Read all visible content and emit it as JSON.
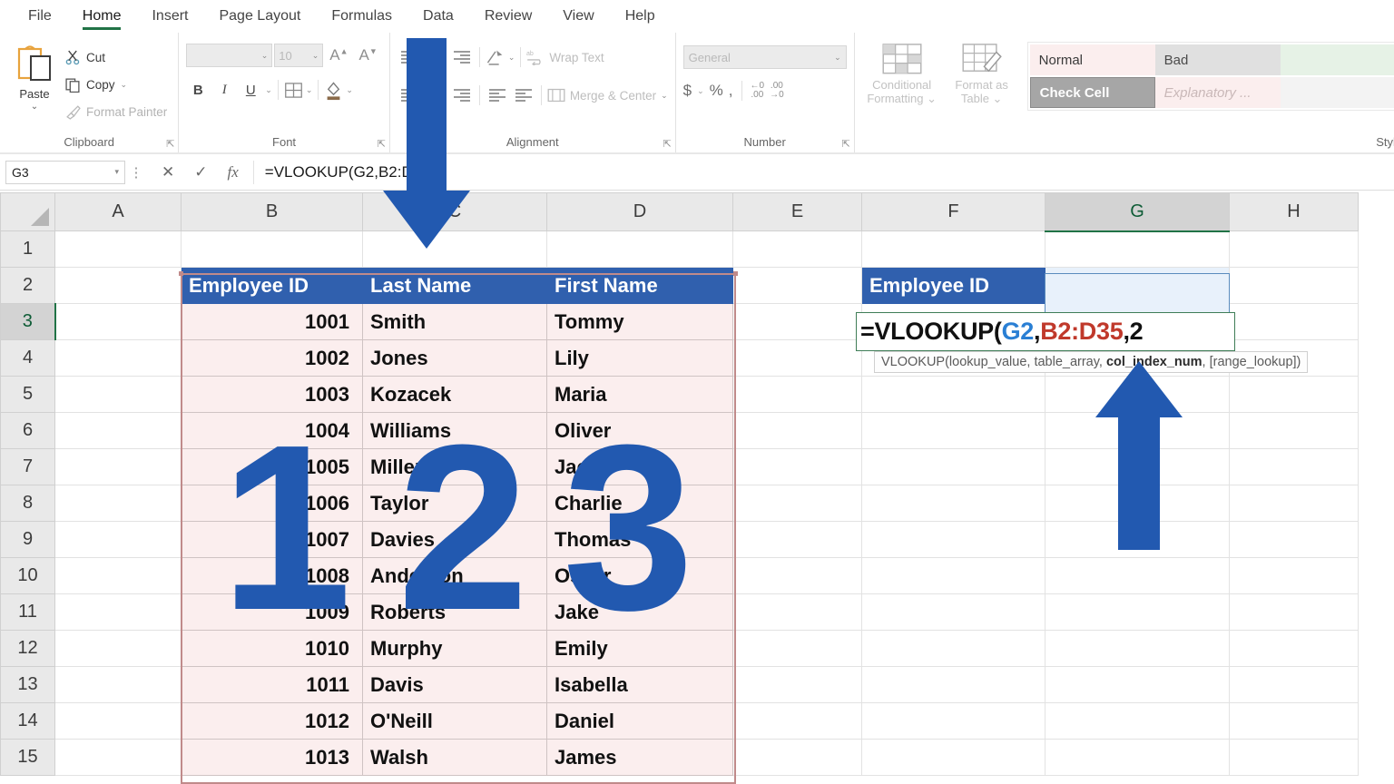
{
  "app": {
    "accent_green": "#217346",
    "annotation_blue": "#2259b0"
  },
  "ribbon": {
    "tabs": [
      {
        "label": "File",
        "active": false
      },
      {
        "label": "Home",
        "active": true
      },
      {
        "label": "Insert",
        "active": false
      },
      {
        "label": "Page Layout",
        "active": false
      },
      {
        "label": "Formulas",
        "active": false
      },
      {
        "label": "Data",
        "active": false
      },
      {
        "label": "Review",
        "active": false
      },
      {
        "label": "View",
        "active": false
      },
      {
        "label": "Help",
        "active": false
      }
    ],
    "clipboard": {
      "group_label": "Clipboard",
      "paste_label": "Paste",
      "cut_label": "Cut",
      "copy_label": "Copy",
      "format_painter_label": "Format Painter"
    },
    "font": {
      "group_label": "Font",
      "font_name": "",
      "font_size": "10",
      "grow_label": "A",
      "shrink_label": "A",
      "bold_label": "B",
      "italic_label": "I",
      "underline_label": "U"
    },
    "alignment": {
      "group_label": "Alignment",
      "wrap_text_label": "Wrap Text",
      "merge_center_label": "Merge & Center",
      "orientation_icon": "text-orientation-icon"
    },
    "number": {
      "group_label": "Number",
      "format_value": "General",
      "currency_label": "$",
      "percent_label": "%",
      "comma_label": ",",
      "increase_decimal_label": ".00",
      "decrease_decimal_label": ".00"
    },
    "styles": {
      "group_label": "Styles",
      "conditional_formatting_label": "Conditional\nFormatting",
      "conditional_formatting_line1": "Conditional",
      "conditional_formatting_line2": "Formatting",
      "format_as_table_line1": "Format as",
      "format_as_table_line2": "Table",
      "gallery": [
        {
          "label": "Normal",
          "state": "normal"
        },
        {
          "label": "Bad",
          "state": "bad"
        },
        {
          "label": "",
          "state": "good"
        },
        {
          "label": "Check Cell",
          "state": "check"
        },
        {
          "label": "Explanatory ...",
          "state": "explanatory"
        },
        {
          "label": "",
          "state": "blank"
        }
      ]
    }
  },
  "formula_bar": {
    "name_box": "G3",
    "cancel_icon": "close-icon",
    "confirm_icon": "check-icon",
    "fx_icon": "fx-icon",
    "formula": "=VLOOKUP(G2,B2:D35,2"
  },
  "grid": {
    "columns": [
      "A",
      "B",
      "C",
      "D",
      "E",
      "F",
      "G",
      "H"
    ],
    "active_column": "G",
    "active_row": "3",
    "rows": [
      "1",
      "2",
      "3",
      "4",
      "5",
      "6",
      "7",
      "8",
      "9",
      "10",
      "11",
      "12",
      "13",
      "14",
      "15"
    ]
  },
  "lookup_table": {
    "range": "B2:D35",
    "headers": [
      "Employee ID",
      "Last Name",
      "First Name"
    ],
    "rows": [
      {
        "row": "3",
        "id": "1001",
        "last": "Smith",
        "first": "Tommy"
      },
      {
        "row": "4",
        "id": "1002",
        "last": "Jones",
        "first": "Lily"
      },
      {
        "row": "5",
        "id": "1003",
        "last": "Kozacek",
        "first": "Maria"
      },
      {
        "row": "6",
        "id": "1004",
        "last": "Williams",
        "first": "Oliver"
      },
      {
        "row": "7",
        "id": "1005",
        "last": "Miller",
        "first": "Jack"
      },
      {
        "row": "8",
        "id": "1006",
        "last": "Taylor",
        "first": "Charlie"
      },
      {
        "row": "9",
        "id": "1007",
        "last": "Davies",
        "first": "Thomas"
      },
      {
        "row": "10",
        "id": "1008",
        "last": "Anderson",
        "first": "Oscar"
      },
      {
        "row": "11",
        "id": "1009",
        "last": "Roberts",
        "first": "Jake"
      },
      {
        "row": "12",
        "id": "1010",
        "last": "Murphy",
        "first": "Emily"
      },
      {
        "row": "13",
        "id": "1011",
        "last": "Davis",
        "first": "Isabella"
      },
      {
        "row": "14",
        "id": "1012",
        "last": "O'Neill",
        "first": "Daniel"
      },
      {
        "row": "15",
        "id": "1013",
        "last": "Walsh",
        "first": "James"
      }
    ]
  },
  "lookup_panel": {
    "header_label": "Employee ID",
    "input_value": "",
    "formula_prefix": "=VLOOKUP(",
    "formula_arg1": "G2",
    "formula_comma1": ",",
    "formula_arg2": "B2:D35",
    "formula_comma2": ",",
    "formula_arg3": "2",
    "tooltip_pre": "VLOOKUP(lookup_value, table_array, ",
    "tooltip_bold": "col_index_num",
    "tooltip_post": ", [range_lookup])"
  },
  "annotations": {
    "step1": "1",
    "step2": "2",
    "step3": "3",
    "arrow_down": "arrow-down-icon",
    "arrow_up": "arrow-up-icon"
  }
}
